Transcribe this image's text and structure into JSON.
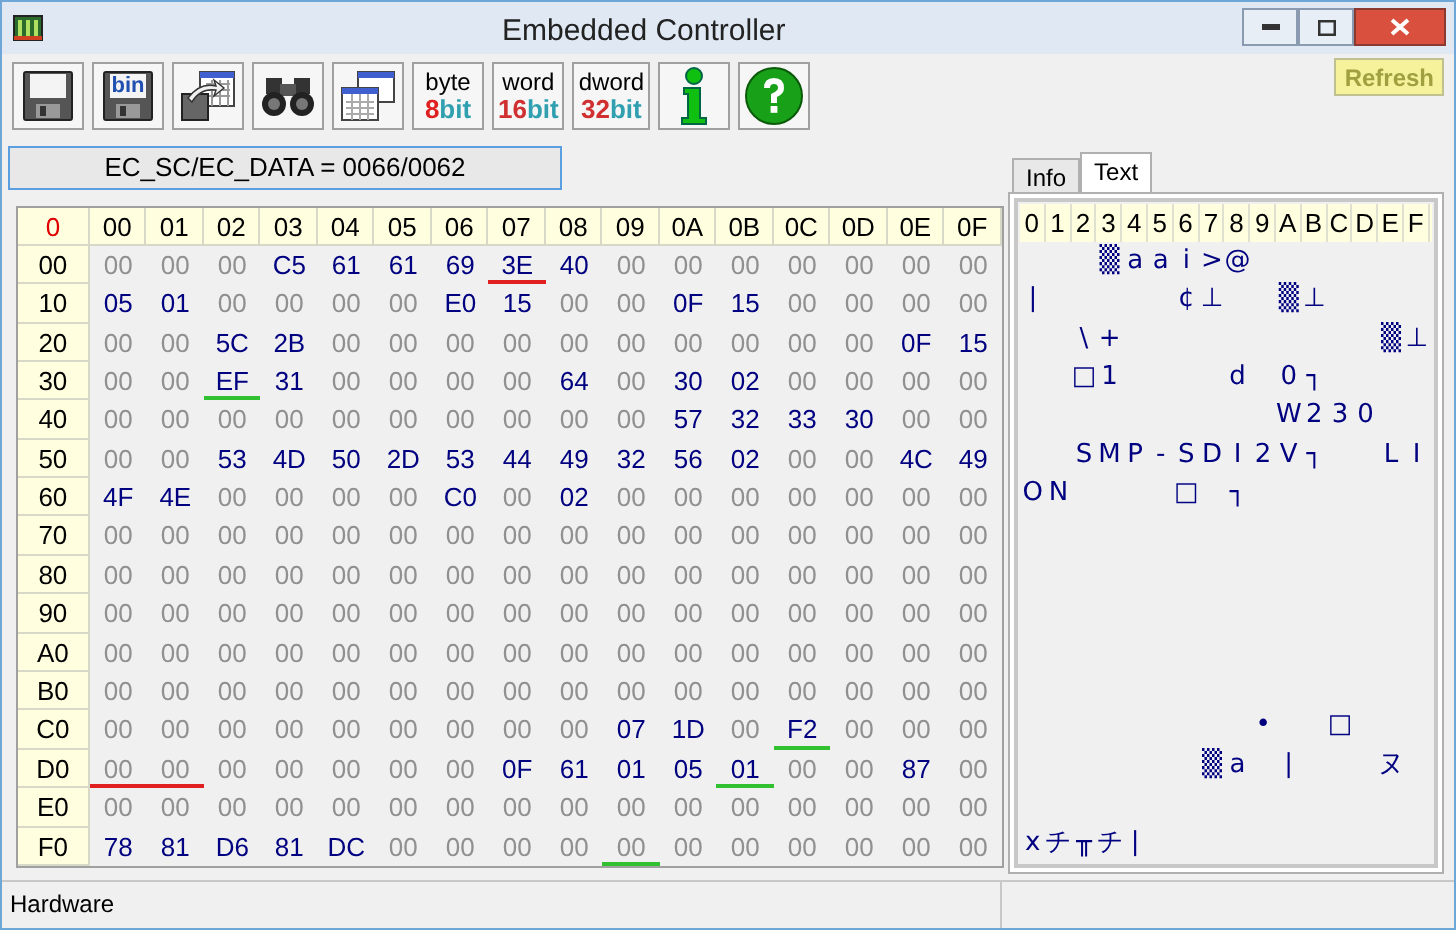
{
  "window": {
    "title": "Embedded Controller"
  },
  "toolbar": [
    {
      "kind": "floppy"
    },
    {
      "kind": "floppy",
      "label": "bin"
    },
    {
      "kind": "export"
    },
    {
      "kind": "binoculars"
    },
    {
      "kind": "windows"
    },
    {
      "kind": "width",
      "label": "byte",
      "number": "8",
      "suffix": "bit",
      "color": "#e02020"
    },
    {
      "kind": "width",
      "label": "word",
      "number": "16",
      "suffix": "bit",
      "color": "#d03030"
    },
    {
      "kind": "width",
      "label": "dword",
      "number": "32",
      "suffix": "bit",
      "color": "#d03030"
    },
    {
      "kind": "info"
    },
    {
      "kind": "help"
    }
  ],
  "refresh_button": "Refresh",
  "port_label": "EC_SC/EC_DATA = 0066/0062",
  "hex_table": {
    "corner": "0",
    "columns": [
      "00",
      "01",
      "02",
      "03",
      "04",
      "05",
      "06",
      "07",
      "08",
      "09",
      "0A",
      "0B",
      "0C",
      "0D",
      "0E",
      "0F"
    ],
    "rows": [
      {
        "label": "00",
        "cells": [
          {
            "v": "00",
            "on": false
          },
          {
            "v": "00",
            "on": false
          },
          {
            "v": "00",
            "on": false
          },
          {
            "v": "C5",
            "on": true
          },
          {
            "v": "61",
            "on": true
          },
          {
            "v": "61",
            "on": true
          },
          {
            "v": "69",
            "on": true
          },
          {
            "v": "3E",
            "on": true,
            "color": "#e02020"
          },
          {
            "v": "40",
            "on": true
          },
          {
            "v": "00",
            "on": false
          },
          {
            "v": "00",
            "on": false
          },
          {
            "v": "00",
            "on": false
          },
          {
            "v": "00",
            "on": false
          },
          {
            "v": "00",
            "on": false
          },
          {
            "v": "00",
            "on": false
          },
          {
            "v": "00",
            "on": false
          }
        ]
      },
      {
        "label": "10",
        "cells": [
          {
            "v": "05",
            "on": true
          },
          {
            "v": "01",
            "on": true
          },
          {
            "v": "00",
            "on": false
          },
          {
            "v": "00",
            "on": false
          },
          {
            "v": "00",
            "on": false
          },
          {
            "v": "00",
            "on": false
          },
          {
            "v": "E0",
            "on": true
          },
          {
            "v": "15",
            "on": true
          },
          {
            "v": "00",
            "on": false
          },
          {
            "v": "00",
            "on": false
          },
          {
            "v": "0F",
            "on": true
          },
          {
            "v": "15",
            "on": true
          },
          {
            "v": "00",
            "on": false
          },
          {
            "v": "00",
            "on": false
          },
          {
            "v": "00",
            "on": false
          },
          {
            "v": "00",
            "on": false
          }
        ]
      },
      {
        "label": "20",
        "cells": [
          {
            "v": "00",
            "on": false
          },
          {
            "v": "00",
            "on": false
          },
          {
            "v": "5C",
            "on": true
          },
          {
            "v": "2B",
            "on": true
          },
          {
            "v": "00",
            "on": false
          },
          {
            "v": "00",
            "on": false
          },
          {
            "v": "00",
            "on": false
          },
          {
            "v": "00",
            "on": false
          },
          {
            "v": "00",
            "on": false
          },
          {
            "v": "00",
            "on": false
          },
          {
            "v": "00",
            "on": false
          },
          {
            "v": "00",
            "on": false
          },
          {
            "v": "00",
            "on": false
          },
          {
            "v": "00",
            "on": false
          },
          {
            "v": "0F",
            "on": true
          },
          {
            "v": "15",
            "on": true
          }
        ]
      },
      {
        "label": "30",
        "cells": [
          {
            "v": "00",
            "on": false
          },
          {
            "v": "00",
            "on": false
          },
          {
            "v": "EF",
            "on": true,
            "color": "#30c030"
          },
          {
            "v": "31",
            "on": true
          },
          {
            "v": "00",
            "on": false
          },
          {
            "v": "00",
            "on": false
          },
          {
            "v": "00",
            "on": false
          },
          {
            "v": "00",
            "on": false
          },
          {
            "v": "64",
            "on": true
          },
          {
            "v": "00",
            "on": false
          },
          {
            "v": "30",
            "on": true
          },
          {
            "v": "02",
            "on": true
          },
          {
            "v": "00",
            "on": false
          },
          {
            "v": "00",
            "on": false
          },
          {
            "v": "00",
            "on": false
          },
          {
            "v": "00",
            "on": false
          }
        ]
      },
      {
        "label": "40",
        "cells": [
          {
            "v": "00",
            "on": false
          },
          {
            "v": "00",
            "on": false
          },
          {
            "v": "00",
            "on": false
          },
          {
            "v": "00",
            "on": false
          },
          {
            "v": "00",
            "on": false
          },
          {
            "v": "00",
            "on": false
          },
          {
            "v": "00",
            "on": false
          },
          {
            "v": "00",
            "on": false
          },
          {
            "v": "00",
            "on": false
          },
          {
            "v": "00",
            "on": false
          },
          {
            "v": "57",
            "on": true
          },
          {
            "v": "32",
            "on": true
          },
          {
            "v": "33",
            "on": true
          },
          {
            "v": "30",
            "on": true
          },
          {
            "v": "00",
            "on": false
          },
          {
            "v": "00",
            "on": false
          }
        ]
      },
      {
        "label": "50",
        "cells": [
          {
            "v": "00",
            "on": false
          },
          {
            "v": "00",
            "on": false
          },
          {
            "v": "53",
            "on": true
          },
          {
            "v": "4D",
            "on": true
          },
          {
            "v": "50",
            "on": true
          },
          {
            "v": "2D",
            "on": true
          },
          {
            "v": "53",
            "on": true
          },
          {
            "v": "44",
            "on": true
          },
          {
            "v": "49",
            "on": true
          },
          {
            "v": "32",
            "on": true
          },
          {
            "v": "56",
            "on": true
          },
          {
            "v": "02",
            "on": true
          },
          {
            "v": "00",
            "on": false
          },
          {
            "v": "00",
            "on": false
          },
          {
            "v": "4C",
            "on": true
          },
          {
            "v": "49",
            "on": true
          }
        ]
      },
      {
        "label": "60",
        "cells": [
          {
            "v": "4F",
            "on": true
          },
          {
            "v": "4E",
            "on": true
          },
          {
            "v": "00",
            "on": false
          },
          {
            "v": "00",
            "on": false
          },
          {
            "v": "00",
            "on": false
          },
          {
            "v": "00",
            "on": false
          },
          {
            "v": "C0",
            "on": true
          },
          {
            "v": "00",
            "on": false
          },
          {
            "v": "02",
            "on": true
          },
          {
            "v": "00",
            "on": false
          },
          {
            "v": "00",
            "on": false
          },
          {
            "v": "00",
            "on": false
          },
          {
            "v": "00",
            "on": false
          },
          {
            "v": "00",
            "on": false
          },
          {
            "v": "00",
            "on": false
          },
          {
            "v": "00",
            "on": false
          }
        ]
      },
      {
        "label": "70",
        "cells": [
          {
            "v": "00",
            "on": false
          },
          {
            "v": "00",
            "on": false
          },
          {
            "v": "00",
            "on": false
          },
          {
            "v": "00",
            "on": false
          },
          {
            "v": "00",
            "on": false
          },
          {
            "v": "00",
            "on": false
          },
          {
            "v": "00",
            "on": false
          },
          {
            "v": "00",
            "on": false
          },
          {
            "v": "00",
            "on": false
          },
          {
            "v": "00",
            "on": false
          },
          {
            "v": "00",
            "on": false
          },
          {
            "v": "00",
            "on": false
          },
          {
            "v": "00",
            "on": false
          },
          {
            "v": "00",
            "on": false
          },
          {
            "v": "00",
            "on": false
          },
          {
            "v": "00",
            "on": false
          }
        ]
      },
      {
        "label": "80",
        "cells": [
          {
            "v": "00",
            "on": false
          },
          {
            "v": "00",
            "on": false
          },
          {
            "v": "00",
            "on": false
          },
          {
            "v": "00",
            "on": false
          },
          {
            "v": "00",
            "on": false
          },
          {
            "v": "00",
            "on": false
          },
          {
            "v": "00",
            "on": false
          },
          {
            "v": "00",
            "on": false
          },
          {
            "v": "00",
            "on": false
          },
          {
            "v": "00",
            "on": false
          },
          {
            "v": "00",
            "on": false
          },
          {
            "v": "00",
            "on": false
          },
          {
            "v": "00",
            "on": false
          },
          {
            "v": "00",
            "on": false
          },
          {
            "v": "00",
            "on": false
          },
          {
            "v": "00",
            "on": false
          }
        ]
      },
      {
        "label": "90",
        "cells": [
          {
            "v": "00",
            "on": false
          },
          {
            "v": "00",
            "on": false
          },
          {
            "v": "00",
            "on": false
          },
          {
            "v": "00",
            "on": false
          },
          {
            "v": "00",
            "on": false
          },
          {
            "v": "00",
            "on": false
          },
          {
            "v": "00",
            "on": false
          },
          {
            "v": "00",
            "on": false
          },
          {
            "v": "00",
            "on": false
          },
          {
            "v": "00",
            "on": false
          },
          {
            "v": "00",
            "on": false
          },
          {
            "v": "00",
            "on": false
          },
          {
            "v": "00",
            "on": false
          },
          {
            "v": "00",
            "on": false
          },
          {
            "v": "00",
            "on": false
          },
          {
            "v": "00",
            "on": false
          }
        ]
      },
      {
        "label": "A0",
        "cells": [
          {
            "v": "00",
            "on": false
          },
          {
            "v": "00",
            "on": false
          },
          {
            "v": "00",
            "on": false
          },
          {
            "v": "00",
            "on": false
          },
          {
            "v": "00",
            "on": false
          },
          {
            "v": "00",
            "on": false
          },
          {
            "v": "00",
            "on": false
          },
          {
            "v": "00",
            "on": false
          },
          {
            "v": "00",
            "on": false
          },
          {
            "v": "00",
            "on": false
          },
          {
            "v": "00",
            "on": false
          },
          {
            "v": "00",
            "on": false
          },
          {
            "v": "00",
            "on": false
          },
          {
            "v": "00",
            "on": false
          },
          {
            "v": "00",
            "on": false
          },
          {
            "v": "00",
            "on": false
          }
        ]
      },
      {
        "label": "B0",
        "cells": [
          {
            "v": "00",
            "on": false
          },
          {
            "v": "00",
            "on": false
          },
          {
            "v": "00",
            "on": false
          },
          {
            "v": "00",
            "on": false
          },
          {
            "v": "00",
            "on": false
          },
          {
            "v": "00",
            "on": false
          },
          {
            "v": "00",
            "on": false
          },
          {
            "v": "00",
            "on": false
          },
          {
            "v": "00",
            "on": false
          },
          {
            "v": "00",
            "on": false
          },
          {
            "v": "00",
            "on": false
          },
          {
            "v": "00",
            "on": false
          },
          {
            "v": "00",
            "on": false
          },
          {
            "v": "00",
            "on": false
          },
          {
            "v": "00",
            "on": false
          },
          {
            "v": "00",
            "on": false
          }
        ]
      },
      {
        "label": "C0",
        "cells": [
          {
            "v": "00",
            "on": false
          },
          {
            "v": "00",
            "on": false
          },
          {
            "v": "00",
            "on": false
          },
          {
            "v": "00",
            "on": false
          },
          {
            "v": "00",
            "on": false
          },
          {
            "v": "00",
            "on": false
          },
          {
            "v": "00",
            "on": false
          },
          {
            "v": "00",
            "on": false
          },
          {
            "v": "00",
            "on": false
          },
          {
            "v": "07",
            "on": true
          },
          {
            "v": "1D",
            "on": true
          },
          {
            "v": "00",
            "on": false
          },
          {
            "v": "F2",
            "on": true,
            "color": "#30c030"
          },
          {
            "v": "00",
            "on": false
          },
          {
            "v": "00",
            "on": false
          },
          {
            "v": "00",
            "on": false
          }
        ]
      },
      {
        "label": "D0",
        "cells": [
          {
            "v": "00",
            "on": false,
            "color": "#e02020"
          },
          {
            "v": "00",
            "on": false,
            "color": "#e02020"
          },
          {
            "v": "00",
            "on": false
          },
          {
            "v": "00",
            "on": false
          },
          {
            "v": "00",
            "on": false
          },
          {
            "v": "00",
            "on": false
          },
          {
            "v": "00",
            "on": false
          },
          {
            "v": "0F",
            "on": true
          },
          {
            "v": "61",
            "on": true
          },
          {
            "v": "01",
            "on": true
          },
          {
            "v": "05",
            "on": true
          },
          {
            "v": "01",
            "on": true,
            "color": "#30c030"
          },
          {
            "v": "00",
            "on": false
          },
          {
            "v": "00",
            "on": false
          },
          {
            "v": "87",
            "on": true
          },
          {
            "v": "00",
            "on": false
          }
        ]
      },
      {
        "label": "E0",
        "cells": [
          {
            "v": "00",
            "on": false
          },
          {
            "v": "00",
            "on": false
          },
          {
            "v": "00",
            "on": false
          },
          {
            "v": "00",
            "on": false
          },
          {
            "v": "00",
            "on": false
          },
          {
            "v": "00",
            "on": false
          },
          {
            "v": "00",
            "on": false
          },
          {
            "v": "00",
            "on": false
          },
          {
            "v": "00",
            "on": false
          },
          {
            "v": "00",
            "on": false
          },
          {
            "v": "00",
            "on": false
          },
          {
            "v": "00",
            "on": false
          },
          {
            "v": "00",
            "on": false
          },
          {
            "v": "00",
            "on": false
          },
          {
            "v": "00",
            "on": false
          },
          {
            "v": "00",
            "on": false
          }
        ]
      },
      {
        "label": "F0",
        "cells": [
          {
            "v": "78",
            "on": true
          },
          {
            "v": "81",
            "on": true
          },
          {
            "v": "D6",
            "on": true
          },
          {
            "v": "81",
            "on": true
          },
          {
            "v": "DC",
            "on": true
          },
          {
            "v": "00",
            "on": false
          },
          {
            "v": "00",
            "on": false
          },
          {
            "v": "00",
            "on": false
          },
          {
            "v": "00",
            "on": false
          },
          {
            "v": "00",
            "on": false,
            "color": "#30c030"
          },
          {
            "v": "00",
            "on": false
          },
          {
            "v": "00",
            "on": false
          },
          {
            "v": "00",
            "on": false
          },
          {
            "v": "00",
            "on": false
          },
          {
            "v": "00",
            "on": false
          },
          {
            "v": "00",
            "on": false
          }
        ]
      }
    ]
  },
  "tabs": [
    {
      "label": "Info",
      "selected": false
    },
    {
      "label": "Text",
      "selected": true
    }
  ],
  "text_panel": {
    "header": [
      "0",
      "1",
      "2",
      "3",
      "4",
      "5",
      "6",
      "7",
      "8",
      "9",
      "A",
      "B",
      "C",
      "D",
      "E",
      "F"
    ],
    "rows": [
      [
        null,
        null,
        null,
        "▒",
        "a",
        "a",
        "i",
        ">",
        "@",
        null,
        null,
        null,
        null,
        null,
        null,
        null
      ],
      [
        "|",
        null,
        null,
        null,
        null,
        null,
        "¢",
        "⊥",
        null,
        null,
        "▒",
        "⊥",
        null,
        null,
        null,
        null
      ],
      [
        null,
        null,
        "\\",
        "+",
        null,
        null,
        null,
        null,
        null,
        null,
        null,
        null,
        null,
        null,
        "▒",
        "⊥"
      ],
      [
        null,
        null,
        "□",
        "1",
        null,
        null,
        null,
        null,
        "d",
        null,
        "0",
        "┐",
        null,
        null,
        null,
        null
      ],
      [
        null,
        null,
        null,
        null,
        null,
        null,
        null,
        null,
        null,
        null,
        "W",
        "2",
        "3",
        "0",
        null,
        null
      ],
      [
        null,
        null,
        "S",
        "M",
        "P",
        "-",
        "S",
        "D",
        "I",
        "2",
        "V",
        "┐",
        null,
        null,
        "L",
        "I"
      ],
      [
        "O",
        "N",
        null,
        null,
        null,
        null,
        "□",
        null,
        "┐",
        null,
        null,
        null,
        null,
        null,
        null,
        null
      ],
      [
        null,
        null,
        null,
        null,
        null,
        null,
        null,
        null,
        null,
        null,
        null,
        null,
        null,
        null,
        null,
        null
      ],
      [
        null,
        null,
        null,
        null,
        null,
        null,
        null,
        null,
        null,
        null,
        null,
        null,
        null,
        null,
        null,
        null
      ],
      [
        null,
        null,
        null,
        null,
        null,
        null,
        null,
        null,
        null,
        null,
        null,
        null,
        null,
        null,
        null,
        null
      ],
      [
        null,
        null,
        null,
        null,
        null,
        null,
        null,
        null,
        null,
        null,
        null,
        null,
        null,
        null,
        null,
        null
      ],
      [
        null,
        null,
        null,
        null,
        null,
        null,
        null,
        null,
        null,
        null,
        null,
        null,
        null,
        null,
        null,
        null
      ],
      [
        null,
        null,
        null,
        null,
        null,
        null,
        null,
        null,
        null,
        "•",
        null,
        null,
        "□",
        null,
        null,
        null
      ],
      [
        null,
        null,
        null,
        null,
        null,
        null,
        null,
        "▒",
        "a",
        null,
        "|",
        null,
        null,
        null,
        "ヌ",
        null
      ],
      [
        null,
        null,
        null,
        null,
        null,
        null,
        null,
        null,
        null,
        null,
        null,
        null,
        null,
        null,
        null,
        null
      ],
      [
        "x",
        "チ",
        "╥",
        "チ",
        "|",
        null,
        null,
        null,
        null,
        null,
        null,
        null,
        null,
        null,
        null,
        null
      ]
    ]
  },
  "status_bar": [
    "Hardware"
  ]
}
